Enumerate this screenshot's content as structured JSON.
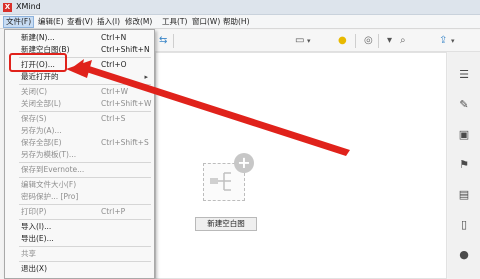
{
  "window": {
    "title": "XMind",
    "logo": "X"
  },
  "menubar": {
    "items": [
      {
        "label": "文件(F)"
      },
      {
        "label": "编辑(E)"
      },
      {
        "label": "查看(V)"
      },
      {
        "label": "插入(I)"
      },
      {
        "label": "修改(M)"
      },
      {
        "label": "工具(T)"
      },
      {
        "label": "窗口(W)"
      },
      {
        "label": "帮助(H)"
      }
    ]
  },
  "file_menu": {
    "items": [
      {
        "label": "新建(N)...",
        "shortcut": "Ctrl+N"
      },
      {
        "label": "新建空白图(B)",
        "shortcut": "Ctrl+Shift+N"
      },
      {
        "label": "打开(O)...",
        "shortcut": "Ctrl+O"
      },
      {
        "label": "最近打开的",
        "shortcut": ""
      },
      {
        "label": "关闭(C)",
        "shortcut": "Ctrl+W"
      },
      {
        "label": "关闭全部(L)",
        "shortcut": "Ctrl+Shift+W"
      },
      {
        "label": "保存(S)",
        "shortcut": "Ctrl+S"
      },
      {
        "label": "另存为(A)...",
        "shortcut": ""
      },
      {
        "label": "保存全部(E)",
        "shortcut": "Ctrl+Shift+S"
      },
      {
        "label": "另存为模板(T)...",
        "shortcut": ""
      },
      {
        "label": "保存到Evernote...",
        "shortcut": ""
      },
      {
        "label": "编辑文件大小(F)",
        "shortcut": ""
      },
      {
        "label": "密码保护... [Pro]",
        "shortcut": ""
      },
      {
        "label": "打印(P)",
        "shortcut": "Ctrl+P"
      },
      {
        "label": "导入(I)...",
        "shortcut": ""
      },
      {
        "label": "导出(E)...",
        "shortcut": ""
      },
      {
        "label": "共享",
        "shortcut": ""
      },
      {
        "label": "退出(X)",
        "shortcut": ""
      }
    ]
  },
  "canvas": {
    "new_blank_label": "新建空白图"
  },
  "colors": {
    "annotation": "#e0221b",
    "accent": "#3a86c8"
  }
}
